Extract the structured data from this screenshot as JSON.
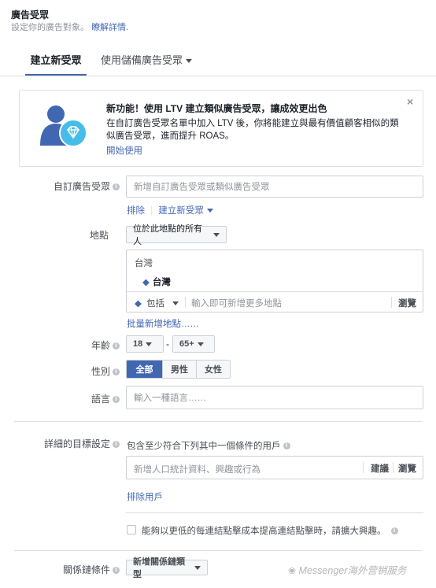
{
  "header": {
    "title": "廣告受眾",
    "subtitle": "設定你的廣告對象。",
    "learn_more": "瞭解詳情."
  },
  "tabs": [
    {
      "label": "建立新受眾"
    },
    {
      "label": "使用儲備廣告受眾"
    }
  ],
  "promo": {
    "title": "新功能！使用 LTV 建立類似廣告受眾，讓成效更出色",
    "body": "在自訂廣告受眾名單中加入 LTV 後，你將能建立與最有價值顧客相似的類似廣告受眾，進而提升 ROAS。",
    "cta": "開始使用",
    "close": "×"
  },
  "custom_audience": {
    "label": "自訂廣告受眾",
    "placeholder": "新增自訂廣告受眾或類似廣告受眾",
    "exclude": "排除",
    "create_new": "建立新受眾"
  },
  "location": {
    "label": "地點",
    "dropdown": "位於此地點的所有人",
    "group_title": "台灣",
    "selected": "台灣",
    "include": "包括",
    "placeholder": "輸入即可新增更多地點",
    "browse": "瀏覽",
    "bulk_add": "批量新增地點……"
  },
  "age": {
    "label": "年齡",
    "min": "18",
    "dash": "-",
    "max": "65+"
  },
  "gender": {
    "label": "性別",
    "options": [
      "全部",
      "男性",
      "女性"
    ],
    "selected": "全部"
  },
  "language": {
    "label": "語言",
    "placeholder": "輸入一種語言……"
  },
  "detailed_targeting": {
    "label": "詳細的目標設定",
    "description": "包含至少符合下列其中一個條件的用戶",
    "placeholder": "新增人口統計資料、興趣或行為",
    "suggestions": "建議",
    "browse": "瀏覽",
    "exclude": "排除用戶",
    "expand_checkbox": "能夠以更低的每連結點擊成本提高連結點擊時，請擴大興趣。"
  },
  "connections": {
    "label": "關係鏈條件",
    "dropdown": "新增關係鏈類型"
  },
  "watermark": {
    "text": "Messenger海外营销服务"
  },
  "colors": {
    "accent": "#4267b2",
    "border": "#ccd0d5",
    "badge": "#45bde8"
  }
}
